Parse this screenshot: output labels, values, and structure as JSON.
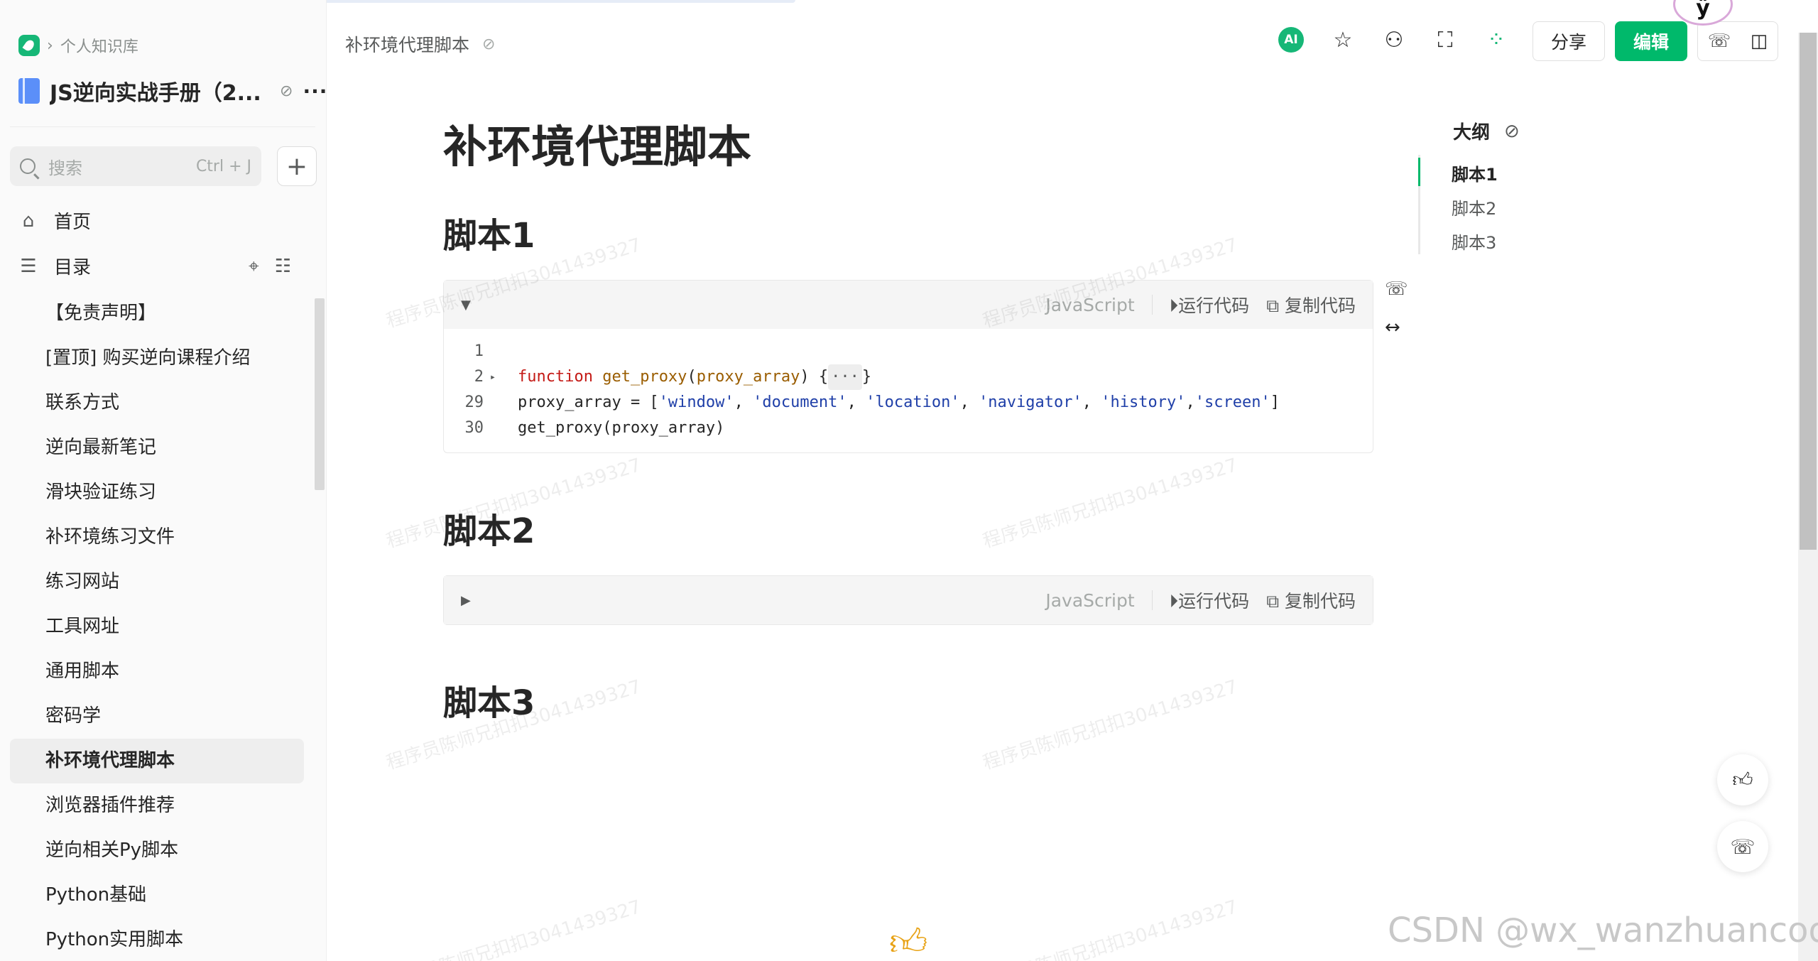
{
  "breadcrumb": {
    "parent": "个人知识库",
    "chevron": "›"
  },
  "book": {
    "title": "JS逆向实战手册（2...",
    "more": "···"
  },
  "search": {
    "placeholder": "搜索",
    "shortcut": "Ctrl + J"
  },
  "nav": {
    "home": "首页",
    "toc": "目录"
  },
  "tree": [
    "【免责声明】",
    "[置顶] 购买逆向课程介绍",
    "联系方式",
    "逆向最新笔记",
    "滑块验证练习",
    "补环境练习文件",
    "练习网站",
    "工具网址",
    "通用脚本",
    "密码学",
    "补环境代理脚本",
    "浏览器插件推荐",
    "逆向相关Py脚本",
    "Python基础",
    "Python实用脚本"
  ],
  "tree_active_index": 10,
  "header": {
    "doc_title": "补环境代理脚本",
    "ai_label": "AI",
    "share": "分享",
    "edit": "编辑",
    "avatar_glyph": "ÿ"
  },
  "doc": {
    "title": "补环境代理脚本",
    "sections": [
      "脚本1",
      "脚本2",
      "脚本3"
    ]
  },
  "codeblock": {
    "lang": "JavaScript",
    "run": "运行代码",
    "copy": "复制代码",
    "lines": [
      {
        "n": "1",
        "fold": "",
        "code": ""
      },
      {
        "n": "2",
        "fold": "▸",
        "code": "function get_proxy(proxy_array) {···}"
      },
      {
        "n": "29",
        "fold": "",
        "code": "proxy_array = ['window', 'document', 'location', 'navigator', 'history','screen']"
      },
      {
        "n": "30",
        "fold": "",
        "code": "get_proxy(proxy_array)"
      }
    ]
  },
  "outline": {
    "title": "大纲",
    "items": [
      "脚本1",
      "脚本2",
      "脚本3"
    ],
    "active_index": 0
  },
  "watermark": "程序员陈师兄扣扣3041439327",
  "csdn_mark": "CSDN @wx_wanzhuancode",
  "colors": {
    "brand_green": "#00b96b",
    "accent_blue": "#5b8ff9"
  }
}
